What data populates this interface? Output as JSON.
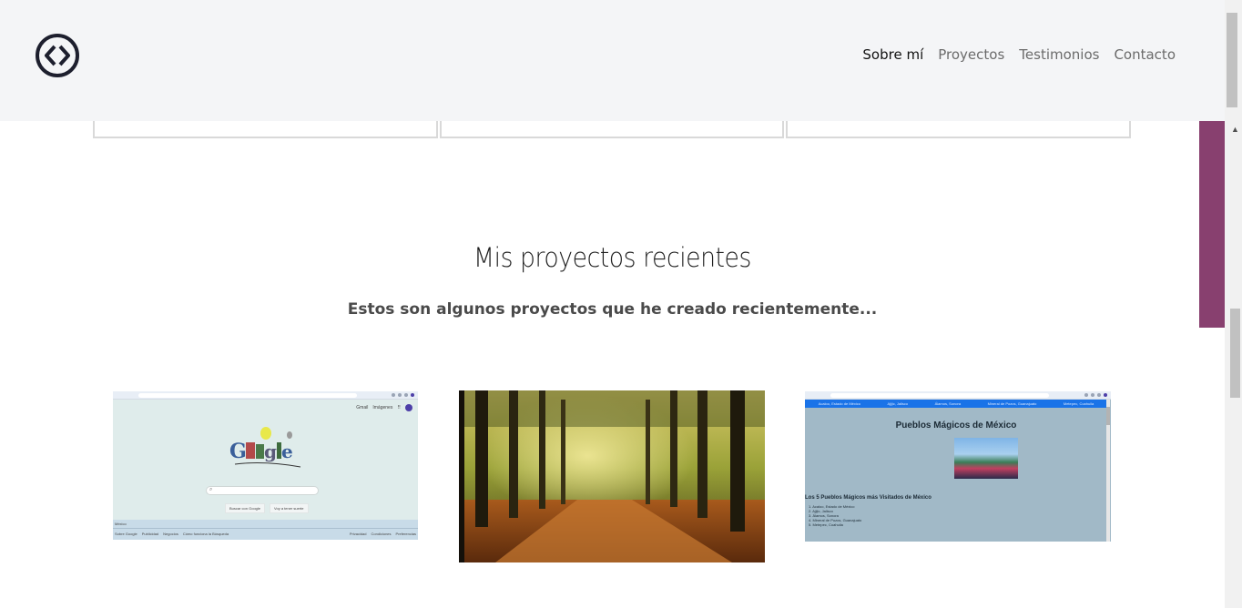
{
  "header": {
    "logo_icon": "code-brackets-circle-icon",
    "nav": [
      {
        "label": "Sobre mí",
        "active": true
      },
      {
        "label": "Proyectos",
        "active": false
      },
      {
        "label": "Testimonios",
        "active": false
      },
      {
        "label": "Contacto",
        "active": false
      }
    ]
  },
  "colors": {
    "accent": "#88406f",
    "header_bg": "#f4f5f7",
    "mini_nav_blue": "#1a73e8"
  },
  "section": {
    "title": "Mis proyectos recientes",
    "subtitle": "Estos son algunos proyectos que he creado recientemente..."
  },
  "projects": {
    "google_clone": {
      "top_links": [
        "Gmail",
        "Imágenes"
      ],
      "search_buttons": [
        "Buscar con Google",
        "Voy a tener suerte"
      ],
      "footer_country": "México",
      "footer_left": [
        "Sobre Google",
        "Publicidad",
        "Negocios",
        "Cómo funciona la Búsqueda"
      ],
      "footer_right": [
        "Privacidad",
        "Condiciones",
        "Preferencias"
      ]
    },
    "forest": {
      "icon": "forest-path-image"
    },
    "pueblos": {
      "nav": [
        "Acaloo, Estado de México",
        "Ajijic, Jalisco",
        "Álamos, Sonora",
        "Mineral de Pozos, Guanajuato",
        "Metepec, Coahuila"
      ],
      "title": "Pueblos Mágicos de México",
      "list_title": "Los 5 Pueblos Mágicos más Visitados de México",
      "list": [
        "1. Acaloo, Estado de México",
        "2. Ajijic, Jalisco",
        "3. Álamos, Sonora",
        "4. Mineral de Pozos, Guanajuato",
        "5. Metepec, Coahuila"
      ]
    }
  }
}
